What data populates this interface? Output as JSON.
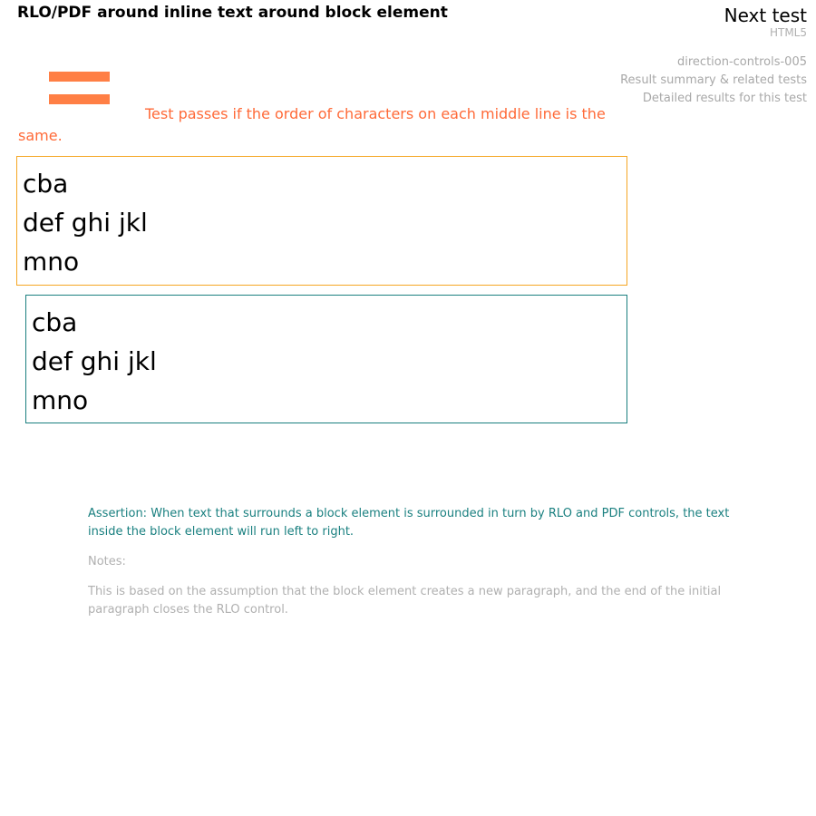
{
  "header": {
    "title": "RLO/PDF around inline text around block element",
    "next_test_label": "Next test",
    "spec_label": "HTML5"
  },
  "meta": {
    "test_id": "direction-controls-005",
    "summary_link": "Result summary & related tests",
    "details_link": "Detailed results for this test"
  },
  "colors": {
    "indicator": "#ff7f45",
    "instructions": "#ff6a38",
    "test_border": "#f5a623",
    "ref_border": "#1a7f7f",
    "assertion": "#1a8080",
    "muted": "#b0b0b0"
  },
  "icon": "equals-icon",
  "instructions": "Test passes if the order of characters on each middle line is the same.",
  "test_box": {
    "lines": [
      "cba",
      "def ghi jkl",
      "mno"
    ]
  },
  "reference_box": {
    "lines": [
      "cba",
      "def ghi jkl",
      "mno"
    ]
  },
  "assertion": "Assertion: When text that surrounds a block element is surrounded in turn by RLO and PDF controls, the text inside the block element will run left to right.",
  "notes": {
    "label": "Notes:",
    "text": "This is based on the assumption that the block element creates a new paragraph, and the end of the initial paragraph closes the RLO control."
  }
}
